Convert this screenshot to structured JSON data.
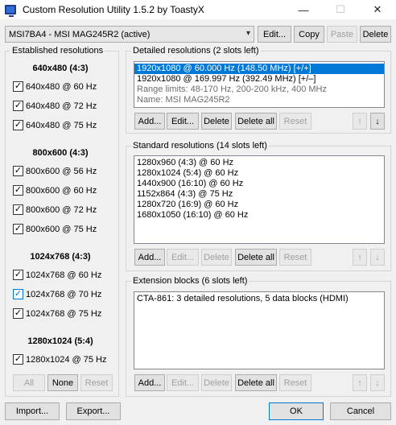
{
  "window": {
    "title": "Custom Resolution Utility 1.5.2 by ToastyX",
    "minimize": "—",
    "maximize": "☐",
    "close": "✕"
  },
  "top": {
    "monitor_select": "MSI7BA4 - MSI MAG245R2 (active)",
    "edit_label": "Edit...",
    "copy_label": "Copy",
    "paste_label": "Paste",
    "delete_label": "Delete"
  },
  "established": {
    "title": "Established resolutions",
    "groups": [
      {
        "heading": "640x480 (4:3)",
        "items": [
          {
            "label": "640x480 @ 60 Hz",
            "check": "✓"
          },
          {
            "label": "640x480 @ 72 Hz",
            "check": "✓"
          },
          {
            "label": "640x480 @ 75 Hz",
            "check": "✓"
          }
        ]
      },
      {
        "heading": "800x600 (4:3)",
        "items": [
          {
            "label": "800x600 @ 56 Hz",
            "check": "✓"
          },
          {
            "label": "800x600 @ 60 Hz",
            "check": "✓"
          },
          {
            "label": "800x600 @ 72 Hz",
            "check": "✓"
          },
          {
            "label": "800x600 @ 75 Hz",
            "check": "✓"
          }
        ]
      },
      {
        "heading": "1024x768 (4:3)",
        "items": [
          {
            "label": "1024x768 @ 60 Hz",
            "check": "✓"
          },
          {
            "label": "1024x768 @ 70 Hz",
            "check": "✓"
          },
          {
            "label": "1024x768 @ 75 Hz",
            "check": "✓"
          }
        ]
      },
      {
        "heading": "1280x1024 (5:4)",
        "items": [
          {
            "label": "1280x1024 @ 75 Hz",
            "check": "✓"
          }
        ]
      }
    ],
    "all_label": "All",
    "none_label": "None",
    "reset_label": "Reset"
  },
  "detailed": {
    "title": "Detailed resolutions (2 slots left)",
    "items": [
      "1920x1080 @ 60.000 Hz (148.50 MHz) [+/+]",
      "1920x1080 @ 169.997 Hz (392.49 MHz) [+/–]",
      "Range limits: 48-170 Hz, 200-200 kHz, 400 MHz",
      "Name: MSI MAG245R2"
    ],
    "add_label": "Add...",
    "edit_label": "Edit...",
    "delete_label": "Delete",
    "delete_all_label": "Delete all",
    "reset_label": "Reset",
    "up_icon": "↑",
    "down_icon": "↓"
  },
  "standard": {
    "title": "Standard resolutions (14 slots left)",
    "items": [
      "1280x960 (4:3) @ 60 Hz",
      "1280x1024 (5:4) @ 60 Hz",
      "1440x900 (16:10) @ 60 Hz",
      "1152x864 (4:3) @ 75 Hz",
      "1280x720 (16:9) @ 60 Hz",
      "1680x1050 (16:10) @ 60 Hz"
    ],
    "add_label": "Add...",
    "edit_label": "Edit...",
    "delete_label": "Delete",
    "delete_all_label": "Delete all",
    "reset_label": "Reset",
    "up_icon": "↑",
    "down_icon": "↓"
  },
  "extension": {
    "title": "Extension blocks (6 slots left)",
    "items": [
      "CTA-861: 3 detailed resolutions, 5 data blocks (HDMI)"
    ],
    "add_label": "Add...",
    "edit_label": "Edit...",
    "delete_label": "Delete",
    "delete_all_label": "Delete all",
    "reset_label": "Reset",
    "up_icon": "↑",
    "down_icon": "↓"
  },
  "bottom": {
    "import_label": "Import...",
    "export_label": "Export...",
    "ok_label": "OK",
    "cancel_label": "Cancel"
  },
  "colors": {
    "selection": "#0078d7",
    "window_bg": "#f0f0f0"
  }
}
